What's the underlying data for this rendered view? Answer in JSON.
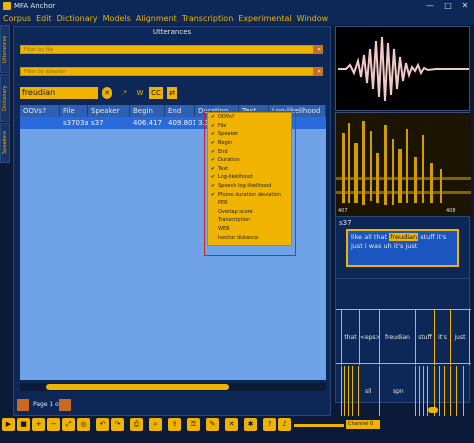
{
  "window": {
    "title": "MFA Anchor",
    "controls": [
      "—",
      "□",
      "✕"
    ]
  },
  "menu": [
    "Corpus",
    "Edit",
    "Dictionary",
    "Models",
    "Alignment",
    "Transcription",
    "Experimental",
    "Window"
  ],
  "left_tabs": [
    "Utterances",
    "Dictionary",
    "Speakers"
  ],
  "utterances": {
    "title": "Utterances",
    "filter_file_placeholder": "Filter by file",
    "filter_speaker_placeholder": "Filter by speaker",
    "search_value": "freudian",
    "search_controls": {
      "clear": "✕",
      "regex": ".*",
      "word": "W",
      "case": "CC"
    },
    "columns": [
      "OOVs?",
      "File",
      "Speaker",
      "Begin",
      "End",
      "Duration",
      "Text",
      "Log-likelihood"
    ],
    "rows": [
      {
        "oov": "",
        "file": "s3703a",
        "speaker": "s37",
        "begin": "406.417",
        "end": "409.801",
        "duration": "3.384",
        "text": "",
        "loglik": ""
      }
    ],
    "column_menu": [
      {
        "label": "OOVs?",
        "checked": true
      },
      {
        "label": "File",
        "checked": true
      },
      {
        "label": "Speaker",
        "checked": true
      },
      {
        "label": "Begin",
        "checked": true
      },
      {
        "label": "End",
        "checked": true
      },
      {
        "label": "Duration",
        "checked": true
      },
      {
        "label": "Text",
        "checked": true
      },
      {
        "label": "Log-likelihood",
        "checked": true
      },
      {
        "label": "Speech log-likelihood",
        "checked": true
      },
      {
        "label": "Phone duration deviation",
        "checked": true
      },
      {
        "label": "PER",
        "checked": false
      },
      {
        "label": "Overlap score",
        "checked": false
      },
      {
        "label": "Transcription",
        "checked": false
      },
      {
        "label": "WER",
        "checked": false
      },
      {
        "label": "Ivector distance",
        "checked": false
      }
    ],
    "pager": "Page 1 of 1"
  },
  "right": {
    "time_ticks": [
      "407",
      "408"
    ],
    "speaker": "s37",
    "utterance_text": {
      "before": "like all that ",
      "highlight": "freudian",
      "after": " stuff it's",
      "line2": "just i was uh it's just"
    },
    "word_tier": [
      "that",
      "<eps>",
      "freudian",
      "stuff",
      "it's",
      "just"
    ],
    "phone_labels": [
      "sil",
      "spn"
    ]
  },
  "toolbar": {
    "channel": "Channel 0"
  },
  "colors": {
    "accent": "#f0b400",
    "panel": "#0d2857",
    "selected_row": "#2a6bdc",
    "highlight_box": "#c4261d"
  }
}
